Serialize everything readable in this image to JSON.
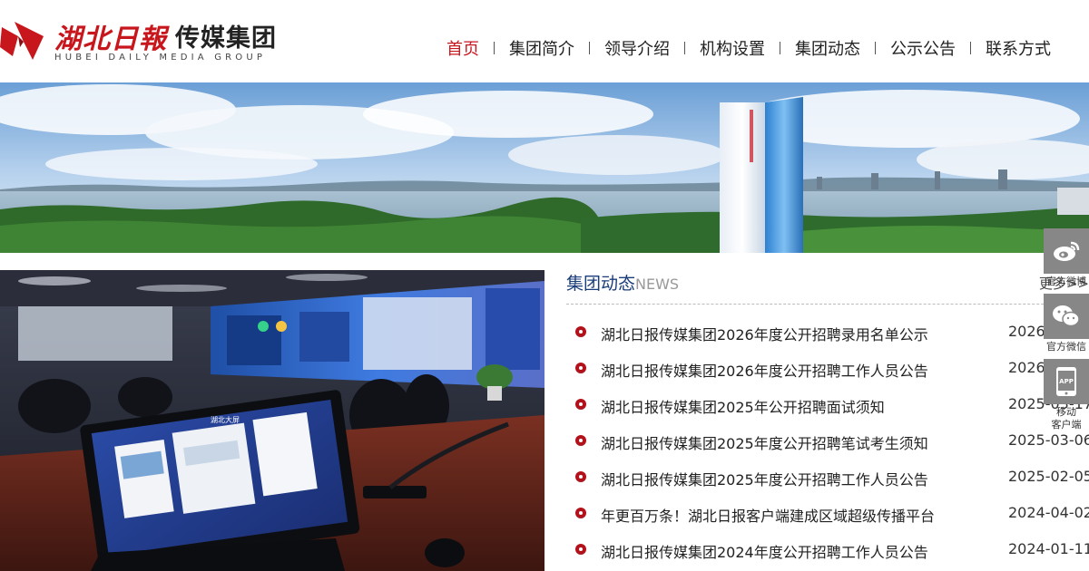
{
  "header": {
    "logo_cn": "湖北日報",
    "logo_cn2": "传媒集团",
    "logo_en": "HUBEI DAILY MEDIA GROUP"
  },
  "nav": {
    "items": [
      {
        "label": "首页",
        "active": true
      },
      {
        "label": "集团简介"
      },
      {
        "label": "领导介绍"
      },
      {
        "label": "机构设置"
      },
      {
        "label": "集团动态"
      },
      {
        "label": "公示公告"
      },
      {
        "label": "联系方式"
      }
    ]
  },
  "news": {
    "title": "集团动态",
    "title_en": "NEWS",
    "more": "更多>>",
    "items": [
      {
        "text": "湖北日报传媒集团2026年度公开招聘录用名单公示",
        "date": "2026-03-27"
      },
      {
        "text": "湖北日报传媒集团2026年度公开招聘工作人员公告",
        "date": "2026-03-06"
      },
      {
        "text": "湖北日报传媒集团2025年公开招聘面试须知",
        "date": "2025-03-17"
      },
      {
        "text": "湖北日报传媒集团2025年度公开招聘笔试考生须知",
        "date": "2025-03-06"
      },
      {
        "text": "湖北日报传媒集团2025年度公开招聘工作人员公告",
        "date": "2025-02-05"
      },
      {
        "text": "年更百万条！湖北日报客户端建成区域超级传播平台",
        "date": "2024-04-02"
      },
      {
        "text": "湖北日报传媒集团2024年度公开招聘工作人员公告",
        "date": "2024-01-11"
      }
    ]
  },
  "side": {
    "weibo": "官方微博",
    "wechat": "官方微信",
    "app_icon": "APP",
    "app_line1": "移动",
    "app_line2": "客户端"
  },
  "photo": {
    "screen_title": "湖北大屏"
  },
  "colors": {
    "brand_red": "#c8161d",
    "news_blue": "#1a3c7a",
    "side_gray": "#878787"
  }
}
